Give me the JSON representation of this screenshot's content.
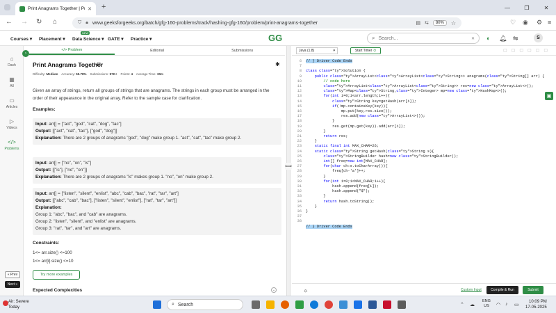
{
  "browser": {
    "tab_title": "Print Anagrams Together | Prac",
    "url": "www.geeksforgeeks.org/batch/gfg-160-problems/track/hashing-gfg-160/problem/print-anagrams-together",
    "zoom": "80%"
  },
  "site": {
    "logo": "GG",
    "menus": [
      {
        "label": "Courses ▾"
      },
      {
        "label": "Placement ▾"
      },
      {
        "label": "Data Science ▾"
      },
      {
        "label": "GATE ▾"
      },
      {
        "label": "Practice ▾"
      }
    ],
    "new_badge": "NEW",
    "search_placeholder": "Search...",
    "avatar_letter": "S"
  },
  "rail": {
    "items": [
      {
        "label": "Dash",
        "icon": "home-icon"
      },
      {
        "label": "All",
        "icon": "grid-icon"
      },
      {
        "label": "Articles",
        "icon": "article-icon"
      },
      {
        "label": "Videos",
        "icon": "video-icon"
      },
      {
        "label": "Problems",
        "icon": "code-icon"
      }
    ],
    "prev": "« Prev",
    "next": "Next »"
  },
  "problem": {
    "tabs": [
      "</> Problem",
      "Editorial",
      "Submissions"
    ],
    "title": "Print Anagrams Together",
    "meta": {
      "difficulty_label": "Difficulty:",
      "difficulty": "Medium",
      "accuracy_label": "Accuracy:",
      "accuracy": "55.78%",
      "submissions_label": "Submissions:",
      "submissions": "97K+",
      "points_label": "Points:",
      "points": "4",
      "time_label": "Average Time:",
      "time": "30m"
    },
    "description": "Given an array of strings, return all groups of strings that are anagrams. The strings in each group must be arranged in the order of their appearance in the original array. Refer to the sample case for clarification.",
    "examples_title": "Examples:",
    "examples": [
      {
        "input_label": "Input:",
        "input": " arr[] = [\"act\", \"god\", \"cat\", \"dog\", \"tac\"]",
        "output_label": "Output:",
        "output": " [[\"act\", \"cat\", \"tac\"], [\"god\", \"dog\"]]",
        "explanation_label": "Explanation:",
        "explanation": " There are 2 groups of anagrams \"god\", \"dog\" make group 1. \"act\", \"cat\", \"tac\" make group 2."
      },
      {
        "input_label": "Input:",
        "input": " arr[] = [\"no\", \"on\", \"is\"]",
        "output_label": "Output:",
        "output": " [[\"is\"], [\"no\", \"on\"]]",
        "explanation_label": "Explanation:",
        "explanation": " There are 2 groups of anagrams \"is\" makes group 1. \"no\", \"on\" make group 2."
      },
      {
        "input_label": "Input:",
        "input": " arr[] = [\"listen\", \"silent\", \"enlist\", \"abc\", \"cab\", \"bac\", \"rat\", \"tar\", \"art\"]",
        "output_label": "Output:",
        "output": " [[\"abc\", \"cab\", \"bac\"], [\"listen\", \"silent\", \"enlist\"], [\"rat\", \"tar\", \"art\"]]",
        "explanation_label": "Explanation:",
        "groups": [
          "Group 1: \"abc\", \"bac\", and \"cab\" are anagrams.",
          "Group 2: \"listen\", \"silent\", and \"enlist\" are anagrams.",
          "Group 3: \"rat\", \"tar\", and \"art\" are anagrams."
        ]
      }
    ],
    "constraints_title": "Constraints:",
    "constraints": [
      "1<= arr.size() <=100",
      "1<= arr[i].size() <=10"
    ],
    "try_more": "Try more examples",
    "expected_title": "Expected Complexities"
  },
  "editor": {
    "language": "Java (1.8)",
    "timer": "Start Timer",
    "lines": [
      "// } Driver Code Ends",
      "",
      "class Solution {",
      "    public ArrayList<ArrayList<String>> anagrams(String[] arr) {",
      "        // code here",
      "        ArrayList<ArrayList<String>> res=new ArrayList<>();",
      "        Map<String,Integer> mp=new HashMap<>();",
      "        for(int i=0;i<arr.length;i++){",
      "            String key=getHash(arr[i]);",
      "            if(!mp.containsKey(key)){",
      "                mp.put(key,res.size());",
      "                res.add(new ArrayList<>());",
      "            }",
      "            res.get(mp.get(key)).add(arr[i]);",
      "        }",
      "        return res;",
      "    }",
      "    static final int MAX_CHAR=26;",
      "    static String getHash(String s){",
      "        StringBuilder hash=new StringBuilder();",
      "        int[] freq=new int[MAX_CHAR];",
      "        for(char ch:s.toCharArray()){",
      "            freq[ch-'a']++;",
      "        }",
      "        for(int i=0;i<MAX_CHAR;i++){",
      "            hash.append(freq[i]);",
      "            hash.append(\"$\");",
      "        }",
      "        return hash.toString();",
      "    }",
      "}",
      "",
      "",
      "// } Driver Code Ends"
    ],
    "line_numbers": [
      "6",
      "7",
      "8",
      "9",
      "10",
      "11",
      "12",
      "13",
      "14",
      "15",
      "16",
      "17",
      "18",
      "19",
      "20",
      "21",
      "22",
      "23",
      "24",
      "25",
      "26",
      "27",
      "28",
      "29",
      "30",
      "31",
      "32",
      "33",
      "34",
      "35",
      "36",
      "37",
      "38"
    ],
    "custom_input": "Custom Input",
    "compile_run": "Compile & Run",
    "submit": "Submit"
  },
  "taskbar": {
    "weather_title": "Air: Severe",
    "weather_sub": "Today",
    "search": "Search",
    "lang_top": "ENG",
    "lang_bottom": "US",
    "time": "10:09 PM",
    "date": "17-05-2025"
  }
}
